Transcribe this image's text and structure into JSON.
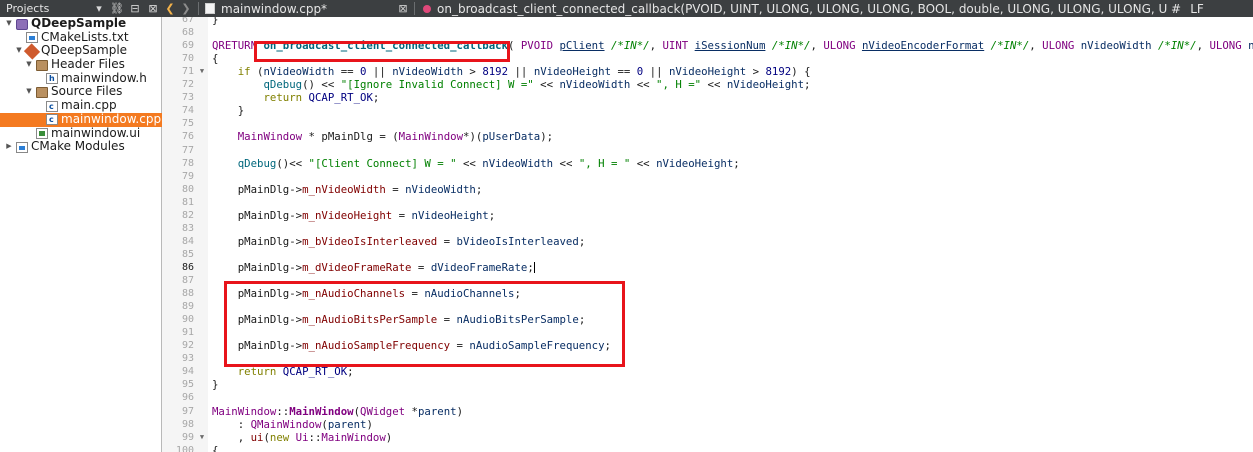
{
  "projects_pane": {
    "title": "Projects",
    "toolbar_icons": [
      "filter-icon",
      "link-icon",
      "split-icon",
      "close-icon"
    ],
    "tree": [
      {
        "label": "QDeepSample",
        "level": 0,
        "arrow": "down",
        "icon": "project-icon",
        "bold": true
      },
      {
        "label": "CMakeLists.txt",
        "level": 1,
        "arrow": "",
        "icon": "cmake-file-icon"
      },
      {
        "label": "QDeepSample",
        "level": 1,
        "arrow": "down",
        "icon": "target-icon"
      },
      {
        "label": "Header Files",
        "level": 2,
        "arrow": "down",
        "icon": "folder-icon"
      },
      {
        "label": "mainwindow.h",
        "level": 3,
        "arrow": "",
        "icon": "header-file-icon"
      },
      {
        "label": "Source Files",
        "level": 2,
        "arrow": "down",
        "icon": "folder-icon"
      },
      {
        "label": "main.cpp",
        "level": 3,
        "arrow": "",
        "icon": "cpp-file-icon"
      },
      {
        "label": "mainwindow.cpp",
        "level": 3,
        "arrow": "",
        "icon": "cpp-file-icon",
        "selected": true
      },
      {
        "label": "mainwindow.ui",
        "level": 2,
        "arrow": "",
        "icon": "ui-file-icon"
      },
      {
        "label": "CMake Modules",
        "level": 0,
        "arrow": "right",
        "icon": "cmake-modules-icon"
      }
    ]
  },
  "editor_bar": {
    "file_name": "mainwindow.cpp*",
    "function_signature": "on_broadcast_client_connected_callback(PVOID, UINT, ULONG, ULONG, ULONG, BOOL, double, ULONG, ULONG, ULONG, ULONG, PVOID): QRETURN",
    "hash": "#",
    "line_ending": "LF"
  },
  "editor": {
    "current_line": 86,
    "lines": [
      {
        "n": "67",
        "fold": "",
        "code": [
          [
            "plain",
            "}"
          ]
        ]
      },
      {
        "n": "68",
        "fold": "",
        "code": []
      },
      {
        "n": "69",
        "fold": "",
        "code": [
          [
            "ty",
            "QRETURN "
          ],
          [
            "fnb",
            "on_broadcast_client_connected_callback"
          ],
          [
            "plain",
            "( "
          ],
          [
            "ty",
            "PVOID "
          ],
          [
            "parm",
            "pClient"
          ],
          [
            "cm",
            " /*IN*/"
          ],
          [
            "plain",
            ", "
          ],
          [
            "ty",
            "UINT "
          ],
          [
            "parm",
            "iSessionNum"
          ],
          [
            "cm",
            " /*IN*/"
          ],
          [
            "plain",
            ", "
          ],
          [
            "ty",
            "ULONG "
          ],
          [
            "parm",
            "nVideoEncoderFormat"
          ],
          [
            "cm",
            " /*IN*/"
          ],
          [
            "plain",
            ", "
          ],
          [
            "ty",
            "ULONG "
          ],
          [
            "par",
            "nVideoWidth"
          ],
          [
            "cm",
            " /*IN*/"
          ],
          [
            "plain",
            ", "
          ],
          [
            "ty",
            "ULONG "
          ],
          [
            "par",
            "nVideoHeight"
          ]
        ]
      },
      {
        "n": "70",
        "fold": "",
        "code": [
          [
            "plain",
            "{"
          ]
        ]
      },
      {
        "n": "71",
        "fold": "down",
        "code": [
          [
            "plain",
            "    "
          ],
          [
            "kw",
            "if"
          ],
          [
            "plain",
            " ("
          ],
          [
            "par",
            "nVideoWidth"
          ],
          [
            "plain",
            " == "
          ],
          [
            "num",
            "0"
          ],
          [
            "plain",
            " || "
          ],
          [
            "par",
            "nVideoWidth"
          ],
          [
            "plain",
            " > "
          ],
          [
            "num",
            "8192"
          ],
          [
            "plain",
            " || "
          ],
          [
            "par",
            "nVideoHeight"
          ],
          [
            "plain",
            " == "
          ],
          [
            "num",
            "0"
          ],
          [
            "plain",
            " || "
          ],
          [
            "par",
            "nVideoHeight"
          ],
          [
            "plain",
            " > "
          ],
          [
            "num",
            "8192"
          ],
          [
            "plain",
            ") {"
          ]
        ]
      },
      {
        "n": "72",
        "fold": "",
        "code": [
          [
            "plain",
            "        "
          ],
          [
            "fn",
            "qDebug"
          ],
          [
            "plain",
            "() << "
          ],
          [
            "str",
            "\"[Ignore Invalid Connect] W =\""
          ],
          [
            "plain",
            " << "
          ],
          [
            "par",
            "nVideoWidth"
          ],
          [
            "plain",
            " << "
          ],
          [
            "str",
            "\", H =\""
          ],
          [
            "plain",
            " << "
          ],
          [
            "par",
            "nVideoHeight"
          ],
          [
            "plain",
            ";"
          ]
        ]
      },
      {
        "n": "73",
        "fold": "",
        "code": [
          [
            "plain",
            "        "
          ],
          [
            "kw",
            "return"
          ],
          [
            "plain",
            " "
          ],
          [
            "mac",
            "QCAP_RT_OK"
          ],
          [
            "plain",
            ";"
          ]
        ]
      },
      {
        "n": "74",
        "fold": "",
        "code": [
          [
            "plain",
            "    }"
          ]
        ]
      },
      {
        "n": "75",
        "fold": "",
        "code": []
      },
      {
        "n": "76",
        "fold": "",
        "code": [
          [
            "plain",
            "    "
          ],
          [
            "ty",
            "MainWindow"
          ],
          [
            "plain",
            " * "
          ],
          [
            "plain",
            "pMainDlg"
          ],
          [
            "plain",
            " = ("
          ],
          [
            "ty",
            "MainWindow"
          ],
          [
            "plain",
            "*)("
          ],
          [
            "par",
            "pUserData"
          ],
          [
            "plain",
            ");"
          ]
        ]
      },
      {
        "n": "77",
        "fold": "",
        "code": []
      },
      {
        "n": "78",
        "fold": "",
        "code": [
          [
            "plain",
            "    "
          ],
          [
            "fn",
            "qDebug"
          ],
          [
            "plain",
            "()<< "
          ],
          [
            "str",
            "\"[Client Connect] W = \""
          ],
          [
            "plain",
            " << "
          ],
          [
            "par",
            "nVideoWidth"
          ],
          [
            "plain",
            " << "
          ],
          [
            "str",
            "\", H = \""
          ],
          [
            "plain",
            " << "
          ],
          [
            "par",
            "nVideoHeight"
          ],
          [
            "plain",
            ";"
          ]
        ]
      },
      {
        "n": "79",
        "fold": "",
        "code": []
      },
      {
        "n": "80",
        "fold": "",
        "code": [
          [
            "plain",
            "    "
          ],
          [
            "plain",
            "pMainDlg"
          ],
          [
            "plain",
            "->"
          ],
          [
            "mem",
            "m_nVideoWidth"
          ],
          [
            "plain",
            " = "
          ],
          [
            "par",
            "nVideoWidth"
          ],
          [
            "plain",
            ";"
          ]
        ]
      },
      {
        "n": "81",
        "fold": "",
        "code": []
      },
      {
        "n": "82",
        "fold": "",
        "code": [
          [
            "plain",
            "    "
          ],
          [
            "plain",
            "pMainDlg"
          ],
          [
            "plain",
            "->"
          ],
          [
            "mem",
            "m_nVideoHeight"
          ],
          [
            "plain",
            " = "
          ],
          [
            "par",
            "nVideoHeight"
          ],
          [
            "plain",
            ";"
          ]
        ]
      },
      {
        "n": "83",
        "fold": "",
        "code": []
      },
      {
        "n": "84",
        "fold": "",
        "code": [
          [
            "plain",
            "    "
          ],
          [
            "plain",
            "pMainDlg"
          ],
          [
            "plain",
            "->"
          ],
          [
            "mem",
            "m_bVideoIsInterleaved"
          ],
          [
            "plain",
            " = "
          ],
          [
            "par",
            "bVideoIsInterleaved"
          ],
          [
            "plain",
            ";"
          ]
        ]
      },
      {
        "n": "85",
        "fold": "",
        "code": []
      },
      {
        "n": "86",
        "fold": "",
        "code": [
          [
            "plain",
            "    "
          ],
          [
            "plain",
            "pMainDlg"
          ],
          [
            "plain",
            "->"
          ],
          [
            "mem",
            "m_dVideoFrameRate"
          ],
          [
            "plain",
            " = "
          ],
          [
            "par",
            "dVideoFrameRate"
          ],
          [
            "plain",
            ";"
          ]
        ],
        "cursor": true
      },
      {
        "n": "87",
        "fold": "",
        "code": []
      },
      {
        "n": "88",
        "fold": "",
        "code": [
          [
            "plain",
            "    "
          ],
          [
            "plain",
            "pMainDlg"
          ],
          [
            "plain",
            "->"
          ],
          [
            "mem",
            "m_nAudioChannels"
          ],
          [
            "plain",
            " = "
          ],
          [
            "par",
            "nAudioChannels"
          ],
          [
            "plain",
            ";"
          ]
        ]
      },
      {
        "n": "89",
        "fold": "",
        "code": []
      },
      {
        "n": "90",
        "fold": "",
        "code": [
          [
            "plain",
            "    "
          ],
          [
            "plain",
            "pMainDlg"
          ],
          [
            "plain",
            "->"
          ],
          [
            "mem",
            "m_nAudioBitsPerSample"
          ],
          [
            "plain",
            " = "
          ],
          [
            "par",
            "nAudioBitsPerSample"
          ],
          [
            "plain",
            ";"
          ]
        ]
      },
      {
        "n": "91",
        "fold": "",
        "code": []
      },
      {
        "n": "92",
        "fold": "",
        "code": [
          [
            "plain",
            "    "
          ],
          [
            "plain",
            "pMainDlg"
          ],
          [
            "plain",
            "->"
          ],
          [
            "mem",
            "m_nAudioSampleFrequency"
          ],
          [
            "plain",
            " = "
          ],
          [
            "par",
            "nAudioSampleFrequency"
          ],
          [
            "plain",
            ";"
          ]
        ]
      },
      {
        "n": "93",
        "fold": "",
        "code": []
      },
      {
        "n": "94",
        "fold": "",
        "code": [
          [
            "plain",
            "    "
          ],
          [
            "kw",
            "return"
          ],
          [
            "plain",
            " "
          ],
          [
            "mac",
            "QCAP_RT_OK"
          ],
          [
            "plain",
            ";"
          ]
        ]
      },
      {
        "n": "95",
        "fold": "",
        "code": [
          [
            "plain",
            "}"
          ]
        ]
      },
      {
        "n": "96",
        "fold": "",
        "code": []
      },
      {
        "n": "97",
        "fold": "",
        "code": [
          [
            "ty",
            "MainWindow"
          ],
          [
            "plain",
            "::"
          ],
          [
            "cls",
            "MainWindow"
          ],
          [
            "plain",
            "("
          ],
          [
            "ty",
            "QWidget"
          ],
          [
            "plain",
            " *"
          ],
          [
            "par",
            "parent"
          ],
          [
            "plain",
            ")"
          ]
        ]
      },
      {
        "n": "98",
        "fold": "",
        "code": [
          [
            "plain",
            "    : "
          ],
          [
            "ty",
            "QMainWindow"
          ],
          [
            "plain",
            "("
          ],
          [
            "par",
            "parent"
          ],
          [
            "plain",
            ")"
          ]
        ]
      },
      {
        "n": "99",
        "fold": "down",
        "code": [
          [
            "plain",
            "    , "
          ],
          [
            "mem",
            "ui"
          ],
          [
            "plain",
            "("
          ],
          [
            "kw",
            "new"
          ],
          [
            "plain",
            " "
          ],
          [
            "ty",
            "Ui"
          ],
          [
            "plain",
            "::"
          ],
          [
            "ty",
            "MainWindow"
          ],
          [
            "plain",
            ")"
          ]
        ]
      },
      {
        "n": "100",
        "fold": "",
        "code": [
          [
            "plain",
            "{"
          ]
        ]
      }
    ]
  },
  "annotation_color": "#e8141b"
}
